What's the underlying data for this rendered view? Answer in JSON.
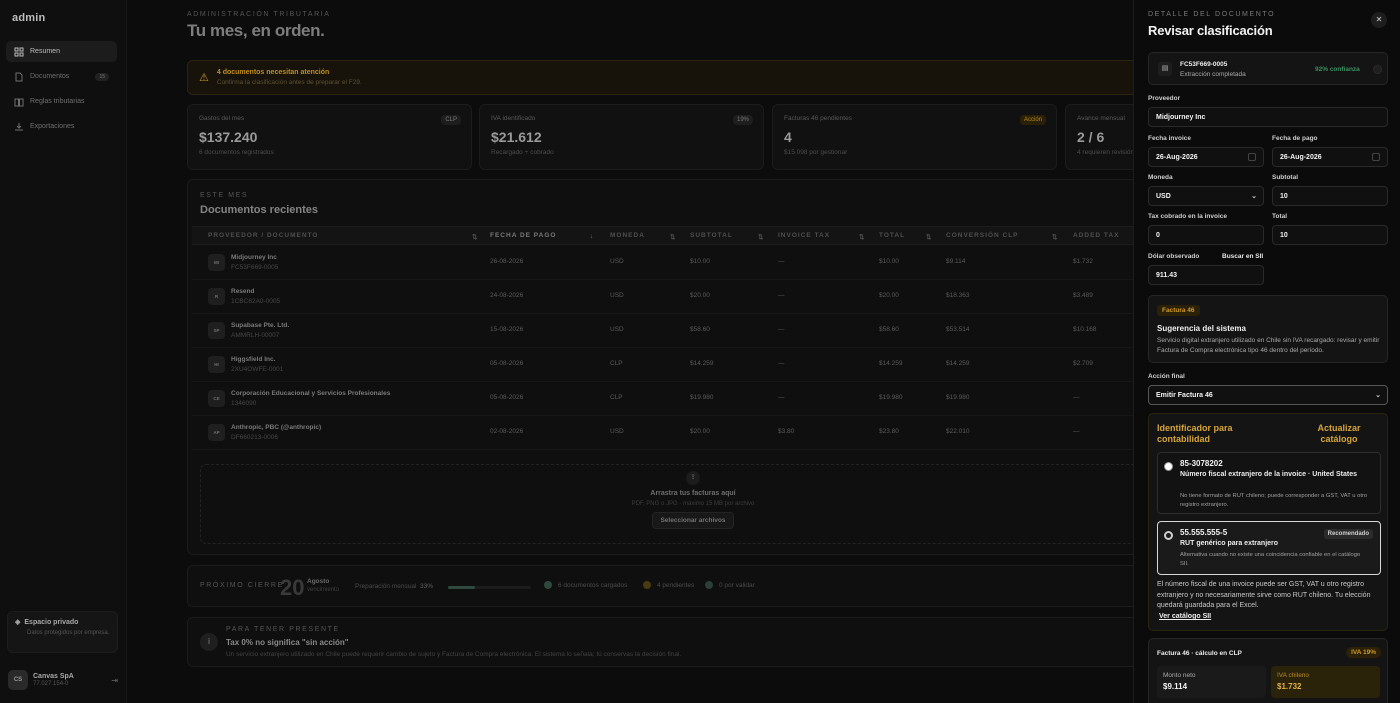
{
  "sidebar": {
    "logo": "admin",
    "items": [
      {
        "label": "Resumen",
        "icon": "grid-icon",
        "active": true
      },
      {
        "label": "Documentos",
        "icon": "document-icon",
        "badge": "15"
      },
      {
        "label": "Reglas tributarias",
        "icon": "book-icon"
      },
      {
        "label": "Exportaciones",
        "icon": "download-icon"
      }
    ],
    "private": {
      "title": "Espacio privado",
      "subtitle": "Datos protegidos por empresa."
    },
    "user": {
      "initials": "CS",
      "name": "Canvas SpA",
      "rut": "77.027.154-0"
    }
  },
  "header": {
    "eyebrow": "ADMINISTRACIÓN TRIBUTARIA",
    "title": "Tu mes, en orden."
  },
  "alert": {
    "title": "4 documentos necesitan atención",
    "subtitle": "Confirma la clasificación antes de preparar el F29."
  },
  "kpis": [
    {
      "label": "Gastos del mes",
      "value": "$137.240",
      "sub": "6 documentos registrados",
      "badge": "CLP"
    },
    {
      "label": "IVA identificado",
      "value": "$21.612",
      "sub": "Recargado + cobrado",
      "badge": "19%"
    },
    {
      "label": "Facturas 46 pendientes",
      "value": "4",
      "sub": "$15.098 por gestionar",
      "badge": "Acción"
    },
    {
      "label": "Avance mensual",
      "value": "2 / 6",
      "sub": "4 requieren revisión",
      "badge": ""
    }
  ],
  "recent": {
    "eyebrow": "ESTE MES",
    "title": "Documentos recientes",
    "columns": [
      "PROVEEDOR / DOCUMENTO",
      "FECHA DE PAGO",
      "MONEDA",
      "SUBTOTAL",
      "INVOICE TAX",
      "TOTAL",
      "CONVERSIÓN CLP",
      "ADDED TAX"
    ],
    "rows": [
      {
        "initials": "MI",
        "name": "Midjourney Inc",
        "doc": "FC53F669-0005",
        "date": "26-08-2026",
        "currency": "USD",
        "subtotal": "$10.00",
        "tax": "—",
        "total": "$10.00",
        "clp": "$9.114",
        "added": "$1.732"
      },
      {
        "initials": "R",
        "name": "Resend",
        "doc": "1CBC62A0-0005",
        "date": "24-08-2026",
        "currency": "USD",
        "subtotal": "$20.00",
        "tax": "—",
        "total": "$20.00",
        "clp": "$18.363",
        "added": "$3.489"
      },
      {
        "initials": "SP",
        "name": "Supabase Pte. Ltd.",
        "doc": "AMMRLH-00007",
        "date": "15-08-2026",
        "currency": "USD",
        "subtotal": "$58.60",
        "tax": "—",
        "total": "$58.60",
        "clp": "$53.514",
        "added": "$10.168"
      },
      {
        "initials": "HI",
        "name": "Higgsfield Inc.",
        "doc": "2XU4OWFE-0001",
        "date": "05-08-2026",
        "currency": "CLP",
        "subtotal": "$14.259",
        "tax": "—",
        "total": "$14.259",
        "clp": "$14.259",
        "added": "$2.709"
      },
      {
        "initials": "CE",
        "name": "Corporación Educacional y Servicios Profesionales",
        "doc": "1346090",
        "date": "05-08-2026",
        "currency": "CLP",
        "subtotal": "$19.980",
        "tax": "—",
        "total": "$19.980",
        "clp": "$19.980",
        "added": "—"
      },
      {
        "initials": "AP",
        "name": "Anthropic, PBC (@anthropic)",
        "doc": "DF660213-0006",
        "date": "02-08-2026",
        "currency": "USD",
        "subtotal": "$20.00",
        "tax": "$3.80",
        "total": "$23.80",
        "clp": "$22.010",
        "added": "—"
      }
    ],
    "drop": {
      "title": "Arrastra tus facturas aquí",
      "subtitle": "PDF, PNG o JPG · máximo 15 MB por archivo",
      "button": "Seleccionar archivos"
    }
  },
  "next": {
    "eyebrow": "PRÓXIMO CIERRE",
    "day": "20",
    "month": "Agosto",
    "month_sub": "vencimiento",
    "prep_label": "Preparación mensual",
    "prep_pct": "33%",
    "prep_fraction": 0.33,
    "stats": [
      {
        "label": "6 documentos cargados",
        "color": "#2e4a3e"
      },
      {
        "label": "4 pendientes",
        "color": "#4a3a12"
      },
      {
        "label": "0 por validar",
        "color": "#2a3f3a"
      }
    ]
  },
  "tip": {
    "eyebrow": "PARA TENER PRESENTE",
    "title": "Tax 0% no significa \"sin acción\"",
    "text": "Un servicio extranjero utilizado en Chile puede requerir cambio de sujeto y Factura de Compra electrónica. El sistema lo señala; tú conservas la decisión final."
  },
  "panel": {
    "eyebrow": "DETALLE DEL DOCUMENTO",
    "title": "Revisar clasificación",
    "file": {
      "name": "FC53F669-0005",
      "status": "Extracción completada",
      "confidence": "92% confianza"
    },
    "fields": {
      "provider_label": "Proveedor",
      "provider": "Midjourney Inc",
      "invoice_date_label": "Fecha invoice",
      "invoice_date": "26-Aug-2026",
      "payment_date_label": "Fecha de pago",
      "payment_date": "26-Aug-2026",
      "currency_label": "Moneda",
      "currency": "USD",
      "subtotal_label": "Subtotal",
      "subtotal": "10",
      "tax_label": "Tax cobrado en la invoice",
      "tax": "0",
      "total_label": "Total",
      "total": "10",
      "dollar_label": "Dólar observado",
      "dollar_link": "Buscar en SII",
      "dollar": "911.43"
    },
    "suggestion": {
      "tag": "Factura 46",
      "title": "Sugerencia del sistema",
      "text": "Servicio digital extranjero utilizado en Chile sin IVA recargado: revisar y emitir Factura de Compra electrónica tipo 46 dentro del período."
    },
    "action_label": "Acción final",
    "action": "Emitir Factura 46",
    "identifier": {
      "title": "Identificador para contabilidad",
      "update": "Actualizar catálogo",
      "options": [
        {
          "code": "85-3078202",
          "name": "Número fiscal extranjero de la invoice · United States",
          "desc": "No tiene formato de RUT chileno; puede corresponder a GST, VAT u otro registro extranjero.",
          "badge": ""
        },
        {
          "code": "55.555.555-5",
          "name": "RUT genérico para extranjero",
          "desc": "Alternativa cuando no existe una coincidencia confiable en el catálogo SII.",
          "badge": "Recomendado"
        }
      ],
      "note": "El número fiscal de una invoice puede ser GST, VAT u otro registro extranjero y no necesariamente sirve como RUT chileno. Tu elección quedará guardada para el Excel.",
      "catalog_link": "Ver catálogo SII"
    },
    "calc": {
      "title": "Factura 46 · cálculo en CLP",
      "badge": "IVA 19%",
      "net_label": "Monto neto",
      "net": "$9.114",
      "iva_label": "IVA chileno",
      "iva": "$1.732"
    }
  }
}
